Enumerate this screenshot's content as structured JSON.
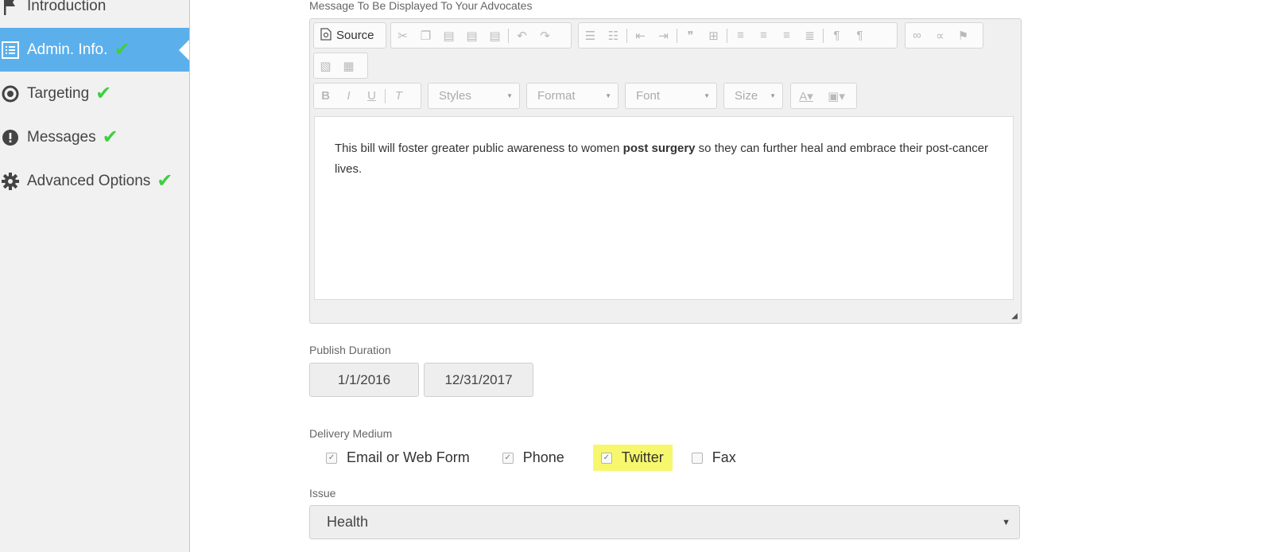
{
  "sidebar": {
    "items": [
      {
        "label": "Introduction",
        "icon": "flag-icon",
        "checked": false,
        "active": false
      },
      {
        "label": "Admin. Info.",
        "icon": "list-icon",
        "checked": true,
        "active": true
      },
      {
        "label": "Targeting",
        "icon": "target-icon",
        "checked": true,
        "active": false
      },
      {
        "label": "Messages",
        "icon": "alert-icon",
        "checked": true,
        "active": false
      },
      {
        "label": "Advanced Options",
        "icon": "gear-icon",
        "checked": true,
        "active": false
      }
    ],
    "check_glyph": "✔",
    "active_color": "#5bb0ec",
    "check_color": "#3fcf3f"
  },
  "editor": {
    "label": "Message To Be Displayed To Your Advocates",
    "source_label": "Source",
    "combos": {
      "styles": "Styles",
      "format": "Format",
      "font": "Font",
      "size": "Size"
    },
    "content": {
      "before": "This bill will foster greater public awareness to women ",
      "bold": "post surgery",
      "after": " so they can further heal and embrace their post-cancer lives."
    }
  },
  "publish": {
    "label": "Publish Duration",
    "start": "1/1/2016",
    "end": "12/31/2017"
  },
  "delivery": {
    "label": "Delivery Medium",
    "options": [
      {
        "label": "Email or Web Form",
        "checked": true,
        "highlighted": false
      },
      {
        "label": "Phone",
        "checked": true,
        "highlighted": false
      },
      {
        "label": "Twitter",
        "checked": true,
        "highlighted": true
      },
      {
        "label": "Fax",
        "checked": false,
        "highlighted": false
      }
    ],
    "highlight_color": "#f7f76d"
  },
  "issue": {
    "label": "Issue",
    "value": "Health"
  }
}
